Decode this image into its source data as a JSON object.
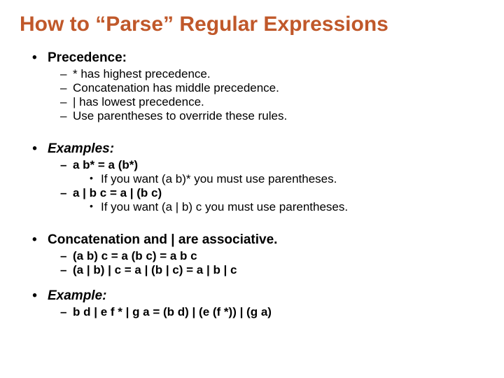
{
  "title": "How to “Parse” Regular Expressions",
  "sections": [
    {
      "heading": "Precedence:",
      "italic": false,
      "items": [
        {
          "text": "* has highest precedence.",
          "bold": false
        },
        {
          "text": "Concatenation has middle precedence.",
          "bold": false
        },
        {
          "text": "| has lowest precedence.",
          "bold": false
        },
        {
          "text": "Use parentheses to override these rules.",
          "bold": false
        }
      ],
      "spacer": "spacer"
    },
    {
      "heading": "Examples:",
      "italic": true,
      "items": [
        {
          "text": "a b* = a (b*)",
          "bold": true,
          "sub": [
            "If you want (a b)* you must use parentheses."
          ]
        },
        {
          "text": "a | b c = a | (b c)",
          "bold": true,
          "sub": [
            "If you want (a | b) c you must use parentheses."
          ]
        }
      ],
      "spacer": "spacer"
    },
    {
      "heading": "Concatenation and | are associative.",
      "italic": false,
      "items": [
        {
          "text": "(a b) c = a (b c) = a b c",
          "bold": true
        },
        {
          "text": "(a | b) | c = a | (b | c) = a | b | c",
          "bold": true
        }
      ],
      "spacer": "spacer-sm"
    },
    {
      "heading": "Example:",
      "italic": true,
      "items": [
        {
          "text": "b d | e f * | g a = (b d) | (e (f *)) | (g a)",
          "bold": true
        }
      ],
      "spacer": "none"
    }
  ]
}
